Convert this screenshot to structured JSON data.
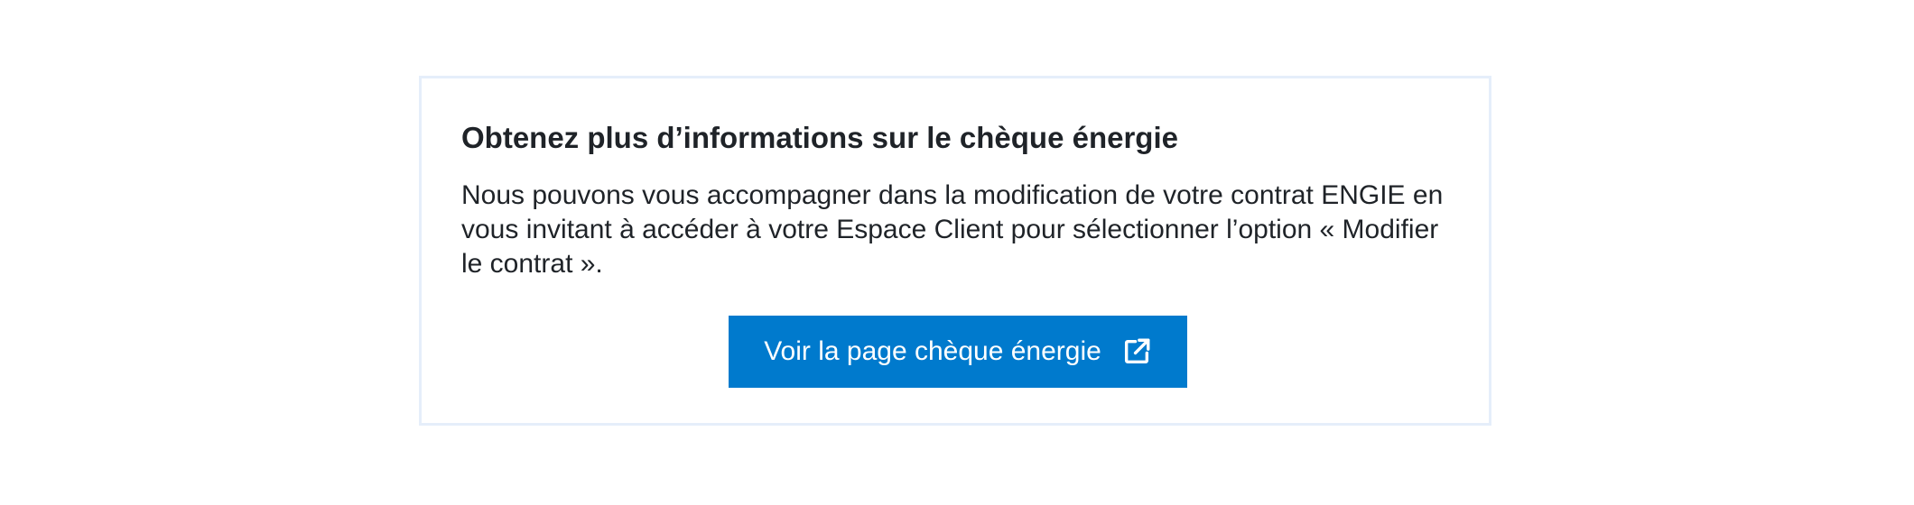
{
  "card": {
    "title": "Obtenez plus d’informations sur le chèque énergie",
    "body": "Nous pouvons vous accompagner dans la modification de votre contrat ENGIE en vous invitant à accéder à votre Espace Client pour sélectionner l’option « Modifier le contrat ».",
    "button": {
      "label": "Voir la page chèque énergie",
      "icon": "external-link-icon"
    }
  },
  "colors": {
    "accent": "#007acd",
    "border": "#e5eefa",
    "text": "#1f2328"
  }
}
